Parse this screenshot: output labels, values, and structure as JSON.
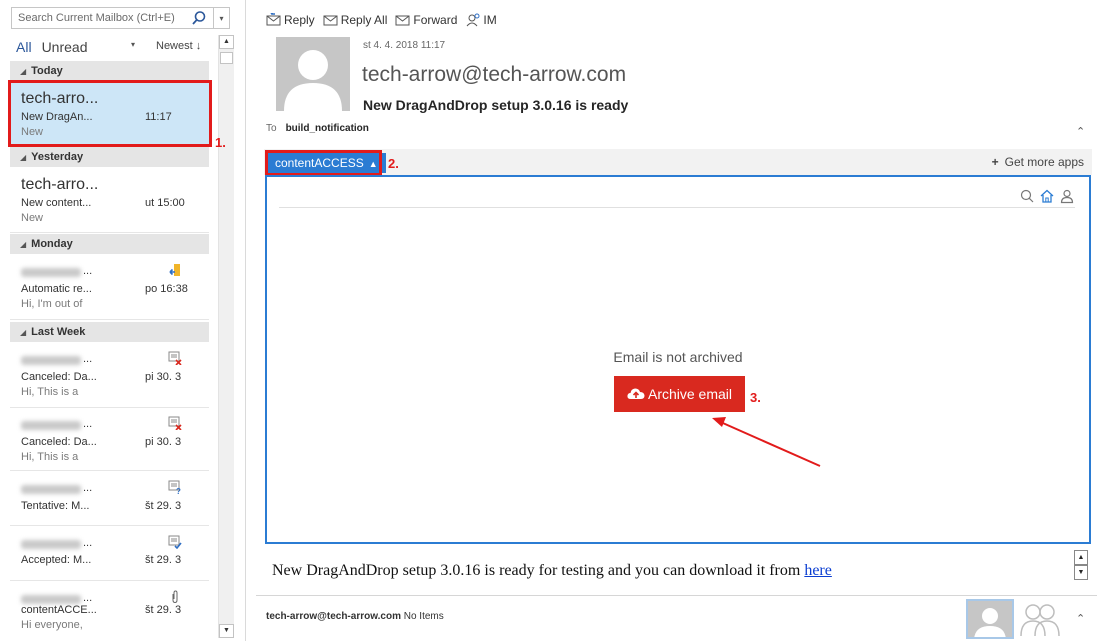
{
  "search": {
    "placeholder": "Search Current Mailbox (Ctrl+E)"
  },
  "filters": {
    "all": "All",
    "unread": "Unread",
    "sort": "Newest ↓"
  },
  "groups": {
    "today": "Today",
    "yesterday": "Yesterday",
    "monday": "Monday",
    "last_week": "Last Week"
  },
  "mails": [
    {
      "sender": "tech-arro...",
      "subject": "New DragAn...",
      "time": "11:17",
      "preview": "New"
    },
    {
      "sender": "tech-arro...",
      "subject": "New content...",
      "time": "ut 15:00",
      "preview": "New"
    },
    {
      "sender": "...",
      "subject": "Automatic re...",
      "time": "po 16:38",
      "preview": "Hi,  I'm out of"
    },
    {
      "sender": "...",
      "subject": "Canceled: Da...",
      "time": "pi 30. 3",
      "preview": "Hi,  This is a"
    },
    {
      "sender": "...",
      "subject": "Canceled: Da...",
      "time": "pi 30. 3",
      "preview": "Hi,  This is a"
    },
    {
      "sender": "...",
      "subject": "Tentative: M...",
      "time": "št 29. 3",
      "preview": ""
    },
    {
      "sender": "...",
      "subject": "Accepted: M...",
      "time": "št 29. 3",
      "preview": ""
    },
    {
      "sender": "...",
      "subject": "contentACCE...",
      "time": "št 29. 3",
      "preview": "Hi everyone,"
    }
  ],
  "toolbar": {
    "reply": "Reply",
    "reply_all": "Reply All",
    "forward": "Forward",
    "im": "IM"
  },
  "message": {
    "date": "st 4. 4. 2018 11:17",
    "from": "tech-arrow@tech-arrow.com",
    "subject": "New DragAndDrop setup 3.0.16 is ready",
    "to_label": "To",
    "to": "build_notification",
    "body": "New DragAndDrop setup 3.0.16 is ready for testing and you can download it from ",
    "body_link": "here"
  },
  "addin": {
    "tab_label": "contentACCESS",
    "get_more": "Get more apps",
    "status": "Email is not archived",
    "archive_button": "Archive email"
  },
  "people": {
    "email": "tech-arrow@tech-arrow.com",
    "items": "No Items"
  },
  "annotations": {
    "step1": "1.",
    "step2": "2.",
    "step3": "3."
  },
  "colors": {
    "accent": "#2b7cd3",
    "archive_button": "#d9291f",
    "annotation_red": "#e21b1b",
    "selected_item": "#cde6f7"
  }
}
